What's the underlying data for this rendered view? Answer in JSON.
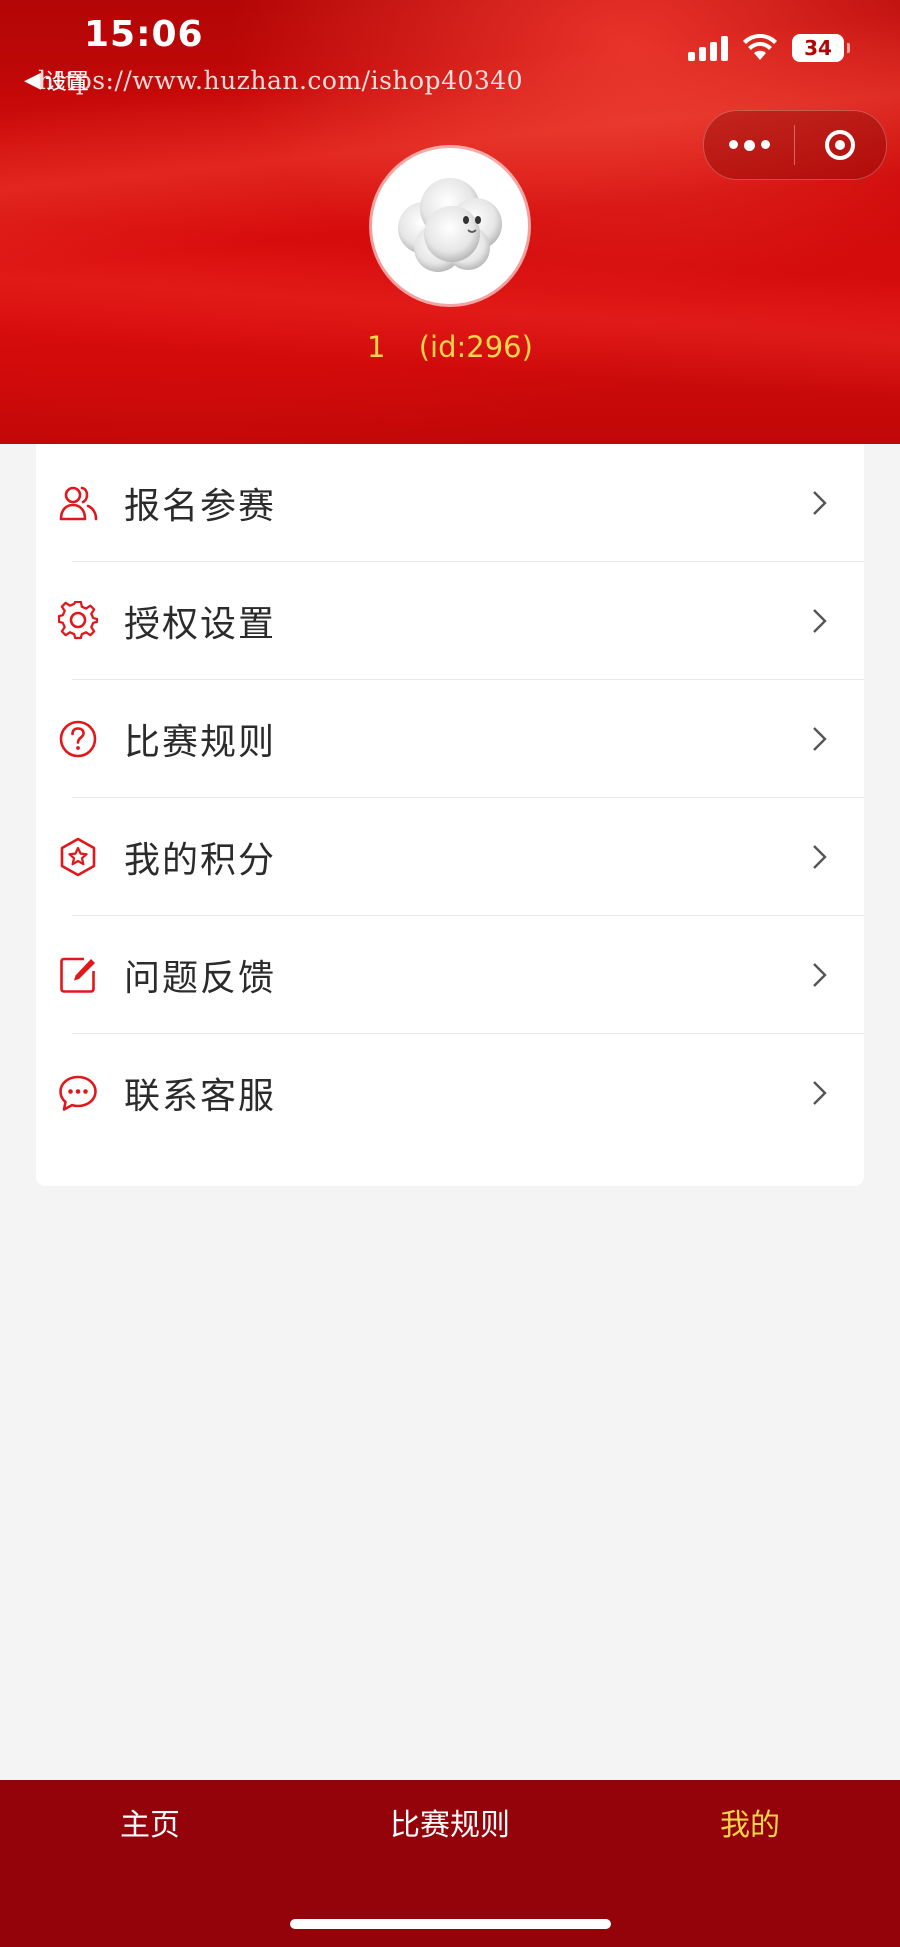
{
  "status_bar": {
    "time": "15:06",
    "battery": "34"
  },
  "nav": {
    "back_label": "设置",
    "watermark": "https://www.huzhan.com/ishop40340"
  },
  "profile": {
    "name": "1",
    "id_text": "(id:296)"
  },
  "menu": {
    "items": [
      {
        "label": "报名参赛",
        "icon": "user-group-icon"
      },
      {
        "label": "授权设置",
        "icon": "gear-icon"
      },
      {
        "label": "比赛规则",
        "icon": "question-circle-icon"
      },
      {
        "label": "我的积分",
        "icon": "star-hexagon-icon"
      },
      {
        "label": "问题反馈",
        "icon": "edit-icon"
      },
      {
        "label": "联系客服",
        "icon": "chat-bubble-icon"
      }
    ]
  },
  "tabbar": {
    "tabs": [
      {
        "label": "主页"
      },
      {
        "label": "比赛规则"
      },
      {
        "label": "我的"
      }
    ],
    "active_index": 2
  },
  "colors": {
    "brand_red": "#d70d0d",
    "tabbar_bg": "#94020a",
    "accent_yellow": "#f7d54a",
    "icon_red": "#e0181b"
  }
}
